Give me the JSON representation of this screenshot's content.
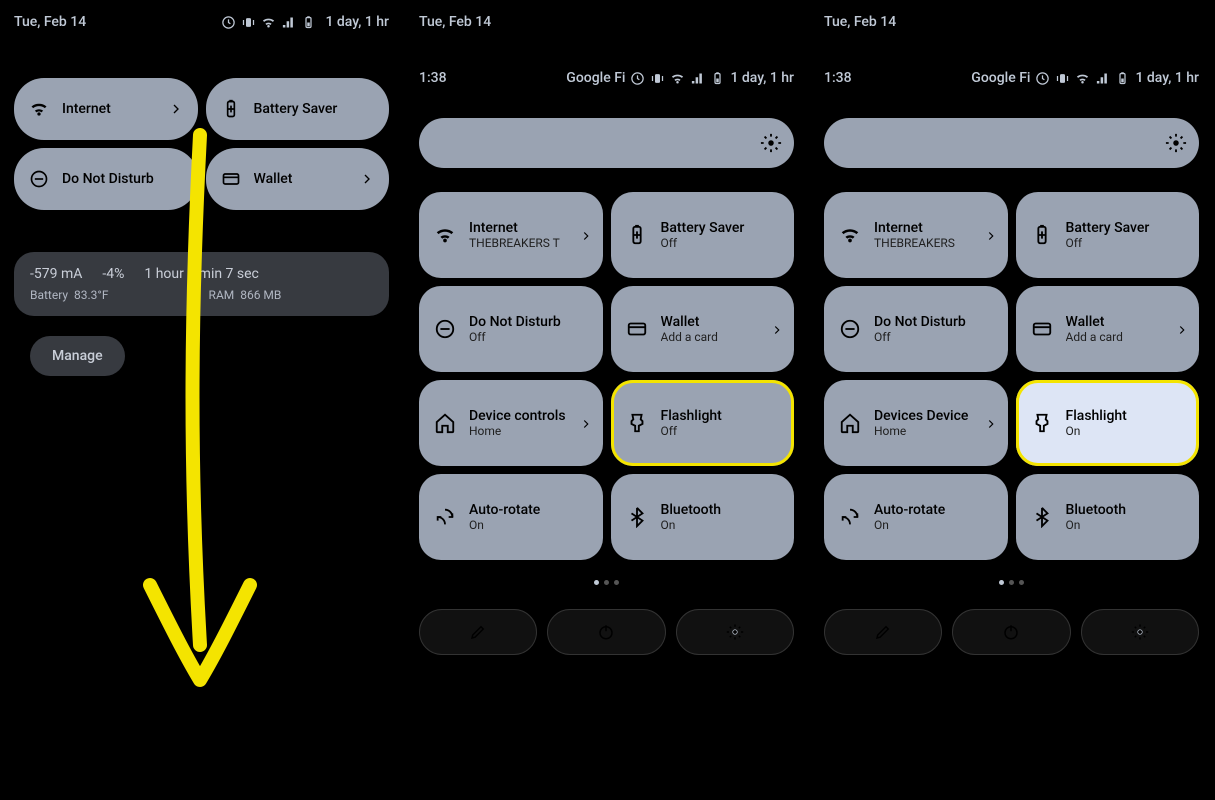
{
  "common": {
    "date": "Tue, Feb 14",
    "time_left": "1 day, 1 hr"
  },
  "panel1": {
    "tiles": {
      "internet": "Internet",
      "battery_saver": "Battery Saver",
      "dnd": "Do Not Disturb",
      "wallet": "Wallet"
    },
    "info": {
      "ma": "-579 mA",
      "pct": "-4%",
      "dur": "1 hour 7 min 7 sec",
      "bat_label": "Battery",
      "bat_val": "83.3°F",
      "ram_label": "RAM",
      "ram_val": "866 MB"
    },
    "manage": "Manage"
  },
  "panel2": {
    "time": "1:38",
    "carrier": "Google Fi",
    "tiles": {
      "internet": {
        "title": "Internet",
        "sub": "THEBREAKERS    T"
      },
      "battery_saver": {
        "title": "Battery Saver",
        "sub": "Off"
      },
      "dnd": {
        "title": "Do Not Disturb",
        "sub": "Off"
      },
      "wallet": {
        "title": "Wallet",
        "sub": "Add a card"
      },
      "device": {
        "title": "Device controls",
        "sub": "Home"
      },
      "flashlight": {
        "title": "Flashlight",
        "sub": "Off"
      },
      "autorotate": {
        "title": "Auto-rotate",
        "sub": "On"
      },
      "bluetooth": {
        "title": "Bluetooth",
        "sub": "On"
      }
    }
  },
  "panel3": {
    "time": "1:38",
    "carrier": "Google Fi",
    "tiles": {
      "internet": {
        "title": "Internet",
        "sub": "THEBREAKERS"
      },
      "battery_saver": {
        "title": "Battery Saver",
        "sub": "Off"
      },
      "dnd": {
        "title": "Do Not Disturb",
        "sub": "Off"
      },
      "wallet": {
        "title": "Wallet",
        "sub": "Add a card"
      },
      "device": {
        "title": "Devices      Device",
        "sub": "Home"
      },
      "flashlight": {
        "title": "Flashlight",
        "sub": "On"
      },
      "autorotate": {
        "title": "Auto-rotate",
        "sub": "On"
      },
      "bluetooth": {
        "title": "Bluetooth",
        "sub": "On"
      }
    }
  }
}
